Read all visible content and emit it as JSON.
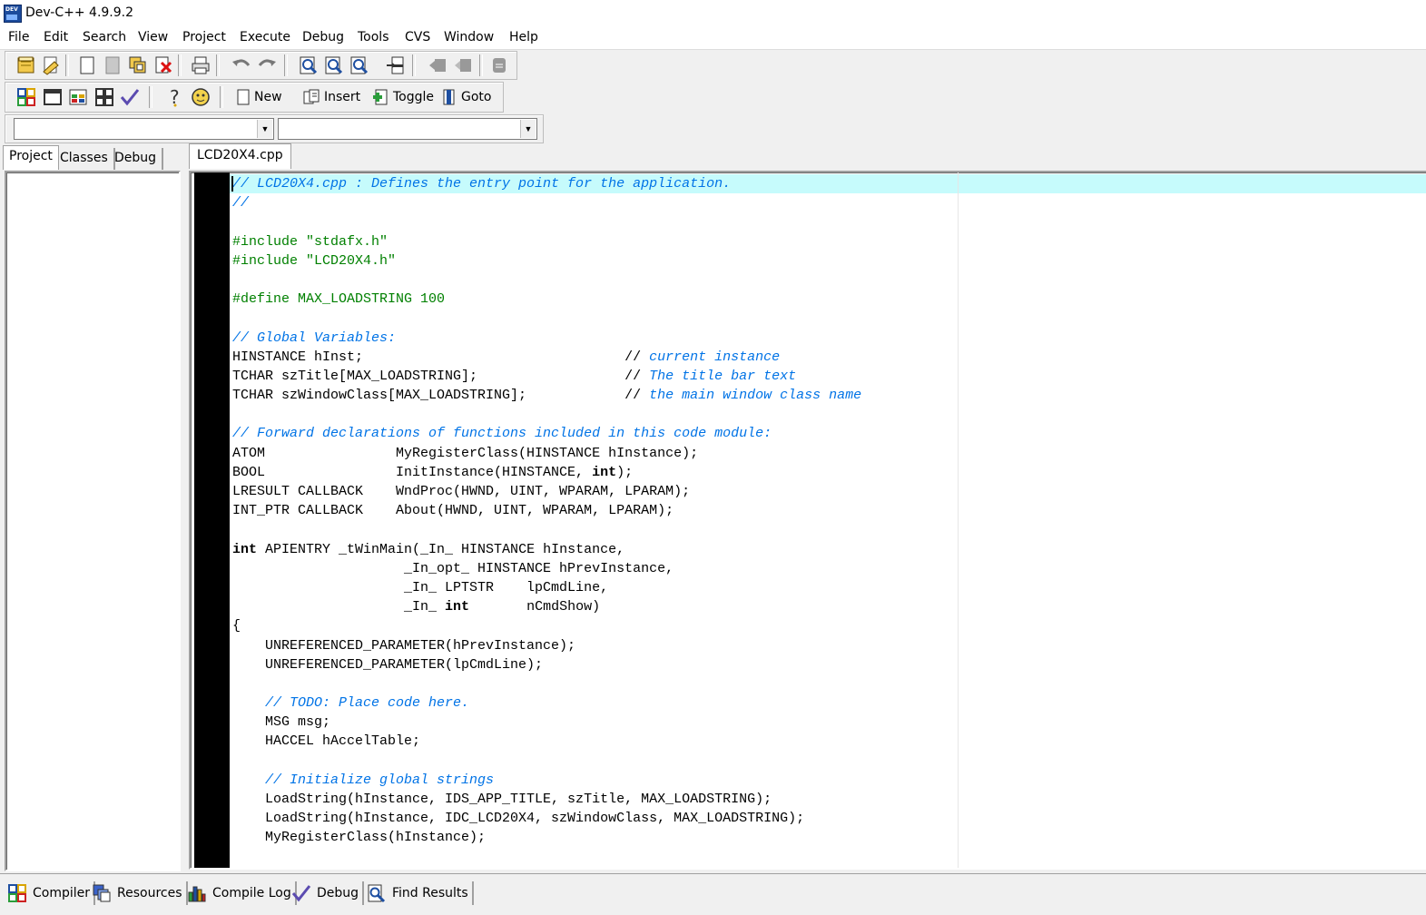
{
  "window": {
    "title": "Dev-C++ 4.9.9.2",
    "app_icon_text": "DEV"
  },
  "menu": [
    "File",
    "Edit",
    "Search",
    "View",
    "Project",
    "Execute",
    "Debug",
    "Tools",
    "CVS",
    "Window",
    "Help"
  ],
  "toolbar2": {
    "new_label": "New",
    "insert_label": "Insert",
    "toggle_label": "Toggle",
    "goto_label": "Goto"
  },
  "combos": {
    "class_value": "",
    "member_value": ""
  },
  "left_tabs": [
    "Project",
    "Classes",
    "Debug"
  ],
  "editor": {
    "file_tab": "LCD20X4.cpp",
    "lines": [
      [
        {
          "t": "// LCD20X4.cpp : Defines the entry point for the application.",
          "c": "comment"
        }
      ],
      [
        {
          "t": "//",
          "c": "comment"
        }
      ],
      [],
      [
        {
          "t": "#include \"stdafx.h\"",
          "c": "pre"
        }
      ],
      [
        {
          "t": "#include \"LCD20X4.h\"",
          "c": "pre"
        }
      ],
      [],
      [
        {
          "t": "#define MAX_LOADSTRING 100",
          "c": "pre"
        }
      ],
      [],
      [
        {
          "t": "// Global Variables:",
          "c": "comment"
        }
      ],
      [
        {
          "t": "HINSTANCE hInst;                                // ",
          "c": "norm"
        },
        {
          "t": "current instance",
          "c": "comment"
        }
      ],
      [
        {
          "t": "TCHAR szTitle[MAX_LOADSTRING];                  // ",
          "c": "norm"
        },
        {
          "t": "The title bar text",
          "c": "comment"
        }
      ],
      [
        {
          "t": "TCHAR szWindowClass[MAX_LOADSTRING];            // ",
          "c": "norm"
        },
        {
          "t": "the main window class name",
          "c": "comment"
        }
      ],
      [],
      [
        {
          "t": "// Forward declarations of functions included in this code module:",
          "c": "comment"
        }
      ],
      [
        {
          "t": "ATOM                MyRegisterClass(HINSTANCE hInstance);",
          "c": "norm"
        }
      ],
      [
        {
          "t": "BOOL                InitInstance(HINSTANCE, ",
          "c": "norm"
        },
        {
          "t": "int",
          "c": "kw"
        },
        {
          "t": ");",
          "c": "norm"
        }
      ],
      [
        {
          "t": "LRESULT CALLBACK    WndProc(HWND, UINT, WPARAM, LPARAM);",
          "c": "norm"
        }
      ],
      [
        {
          "t": "INT_PTR CALLBACK    About(HWND, UINT, WPARAM, LPARAM);",
          "c": "norm"
        }
      ],
      [],
      [
        {
          "t": "int",
          "c": "kw"
        },
        {
          "t": " APIENTRY _tWinMain(_In_ HINSTANCE hInstance,",
          "c": "norm"
        }
      ],
      [
        {
          "t": "                     _In_opt_ HINSTANCE hPrevInstance,",
          "c": "norm"
        }
      ],
      [
        {
          "t": "                     _In_ LPTSTR    lpCmdLine,",
          "c": "norm"
        }
      ],
      [
        {
          "t": "                     _In_ ",
          "c": "norm"
        },
        {
          "t": "int",
          "c": "kw"
        },
        {
          "t": "       nCmdShow)",
          "c": "norm"
        }
      ],
      [
        {
          "t": "{",
          "c": "norm"
        }
      ],
      [
        {
          "t": "    UNREFERENCED_PARAMETER(hPrevInstance);",
          "c": "norm"
        }
      ],
      [
        {
          "t": "    UNREFERENCED_PARAMETER(lpCmdLine);",
          "c": "norm"
        }
      ],
      [],
      [
        {
          "t": "    ",
          "c": "norm"
        },
        {
          "t": "// TODO: Place code here.",
          "c": "comment"
        }
      ],
      [
        {
          "t": "    MSG msg;",
          "c": "norm"
        }
      ],
      [
        {
          "t": "    HACCEL hAccelTable;",
          "c": "norm"
        }
      ],
      [],
      [
        {
          "t": "    ",
          "c": "norm"
        },
        {
          "t": "// Initialize global strings",
          "c": "comment"
        }
      ],
      [
        {
          "t": "    LoadString(hInstance, IDS_APP_TITLE, szTitle, MAX_LOADSTRING);",
          "c": "norm"
        }
      ],
      [
        {
          "t": "    LoadString(hInstance, IDC_LCD20X4, szWindowClass, MAX_LOADSTRING);",
          "c": "norm"
        }
      ],
      [
        {
          "t": "    MyRegisterClass(hInstance);",
          "c": "norm"
        }
      ]
    ]
  },
  "bottom_tabs": [
    "Compiler",
    "Resources",
    "Compile Log",
    "Debug",
    "Find Results"
  ],
  "colors": {
    "comment": "#0073e6",
    "preprocessor": "#008000",
    "active_line": "#c6fbfc",
    "gutter": "#000000"
  }
}
